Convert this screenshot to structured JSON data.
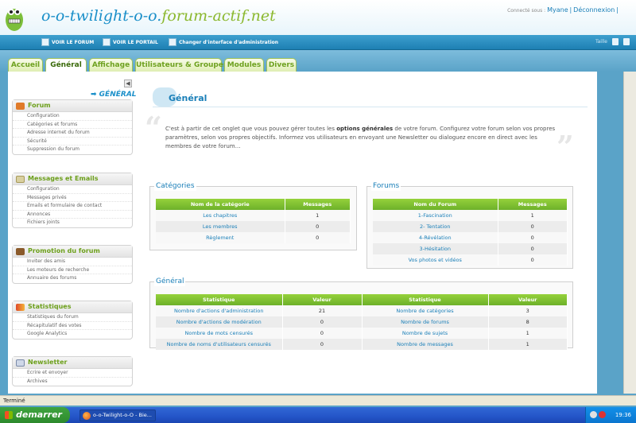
{
  "header": {
    "site_title_prefix": "o-o-twilight-o-o.",
    "site_title_suffix": "forum-actif.net",
    "connected_label": "Connecté sous :",
    "username": "Myane",
    "separator": "|",
    "logout": "Déconnexion"
  },
  "navbar": {
    "links": [
      "VOIR LE FORUM",
      "VOIR LE PORTAIL",
      "Changer d'interface d'administration"
    ],
    "right_label": "Taille"
  },
  "tabs": [
    "Accueil",
    "Général",
    "Affichage",
    "Utilisateurs & Groupes",
    "Modules",
    "Divers"
  ],
  "active_tab": "Général",
  "sidebar": {
    "section_label": "➡ GÉNÉRAL",
    "sections": [
      {
        "title": "Forum",
        "items": [
          "Configuration",
          "Catégories et forums",
          "Adresse internet du forum",
          "Sécurité",
          "Suppression du forum"
        ]
      },
      {
        "title": "Messages et Emails",
        "items": [
          "Configuration",
          "Messages privés",
          "Emails et formulaire de contact",
          "Annonces",
          "Fichiers joints"
        ]
      },
      {
        "title": "Promotion du forum",
        "items": [
          "Inviter des amis",
          "Les moteurs de recherche",
          "Annuaire des forums"
        ]
      },
      {
        "title": "Statistiques",
        "items": [
          "Statistiques du forum",
          "Récapitulatif des votes",
          "Google Analytics"
        ]
      },
      {
        "title": "Newsletter",
        "items": [
          "Ecrire et envoyer",
          "Archives"
        ]
      }
    ]
  },
  "main": {
    "title": "Général",
    "intro_before": "C'est à partir de cet onglet que vous pouvez gérer toutes les ",
    "intro_bold": "options générales",
    "intro_after": " de votre forum. Configurez votre forum selon vos propres paramètres, selon vos propres objectifs. Informez vos utilisateurs en envoyant une Newsletter ou dialoguez encore en direct avec les membres de votre forum…",
    "categories": {
      "legend": "Catégories",
      "headers": [
        "Nom de la catégorie",
        "Messages"
      ],
      "rows": [
        [
          "Les chapitres",
          "1"
        ],
        [
          "Les membres",
          "0"
        ],
        [
          "Règlement",
          "0"
        ]
      ]
    },
    "forums": {
      "legend": "Forums",
      "headers": [
        "Nom du Forum",
        "Messages"
      ],
      "rows": [
        [
          "1-Fascination",
          "1"
        ],
        [
          "2- Tentation",
          "0"
        ],
        [
          "4-Révélation",
          "0"
        ],
        [
          "3-Hésitation",
          "0"
        ],
        [
          "Vos photos et vidéos",
          "0"
        ]
      ]
    },
    "general": {
      "legend": "Général",
      "headers": [
        "Statistique",
        "Valeur",
        "Statistique",
        "Valeur"
      ],
      "rows": [
        [
          "Nombre d'actions d'administration",
          "21",
          "Nombre de catégories",
          "3"
        ],
        [
          "Nombre d'actions de modération",
          "0",
          "Nombre de forums",
          "8"
        ],
        [
          "Nombre de mots censurés",
          "0",
          "Nombre de sujets",
          "1"
        ],
        [
          "Nombre de noms d'utilisateurs censurés",
          "0",
          "Nombre de messages",
          "1"
        ]
      ]
    }
  },
  "status": "Terminé",
  "taskbar": {
    "start": "demarrer",
    "task": "o-o-Twilight-o-O - Bie...",
    "clock": "19:36"
  }
}
